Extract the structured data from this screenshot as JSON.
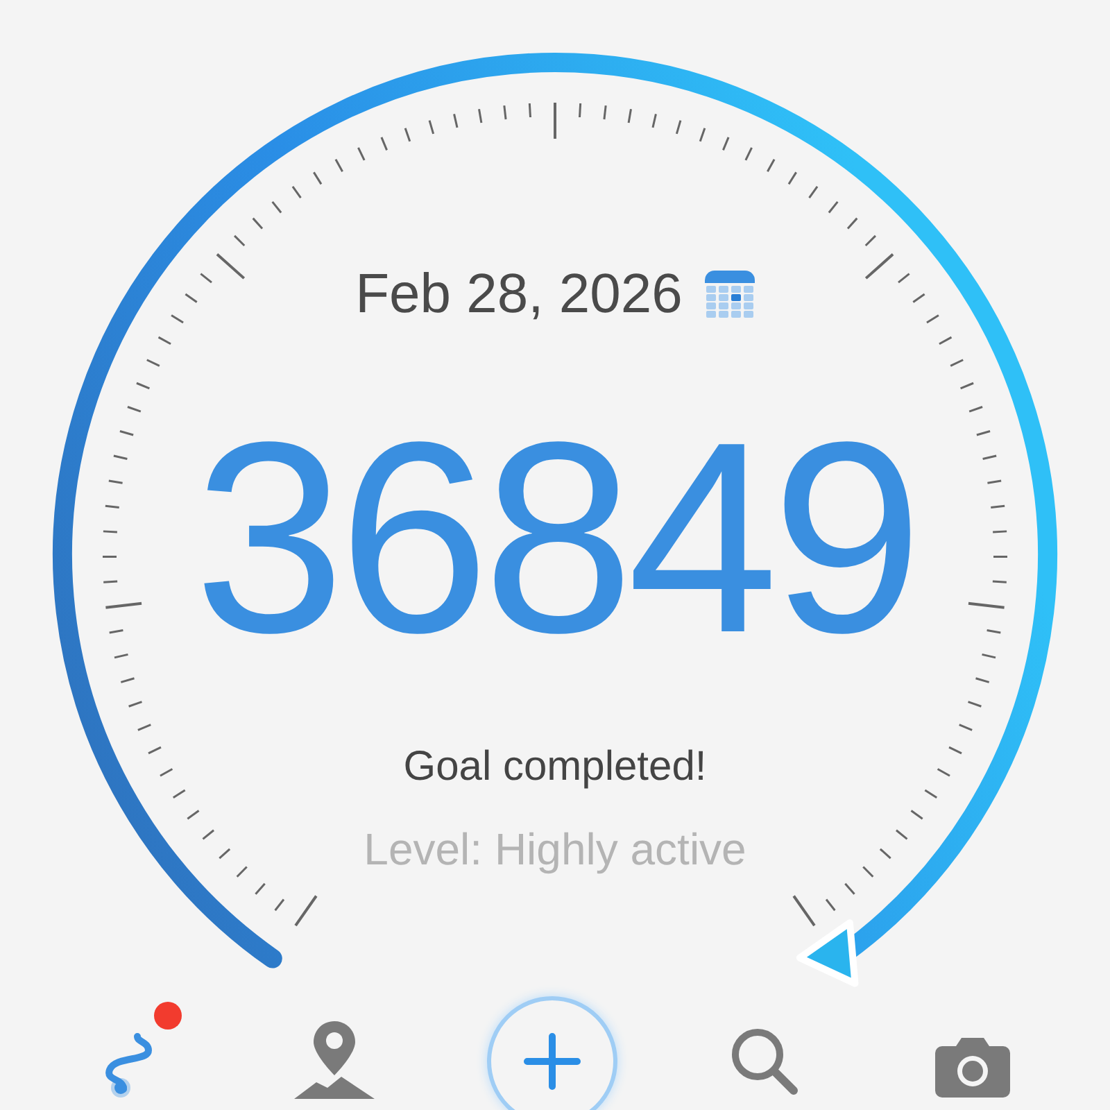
{
  "date": "Feb 28, 2026",
  "steps": "36849",
  "message": "Goal completed!",
  "activity": "Level: Highly active",
  "nav": [
    {
      "kind": "route",
      "selected": true,
      "badge": true
    },
    {
      "kind": "map",
      "selected": false,
      "badge": false
    },
    {
      "kind": "add",
      "selected": false,
      "badge": false
    },
    {
      "kind": "search",
      "selected": false,
      "badge": false
    },
    {
      "kind": "camera",
      "selected": false,
      "badge": false
    }
  ]
}
